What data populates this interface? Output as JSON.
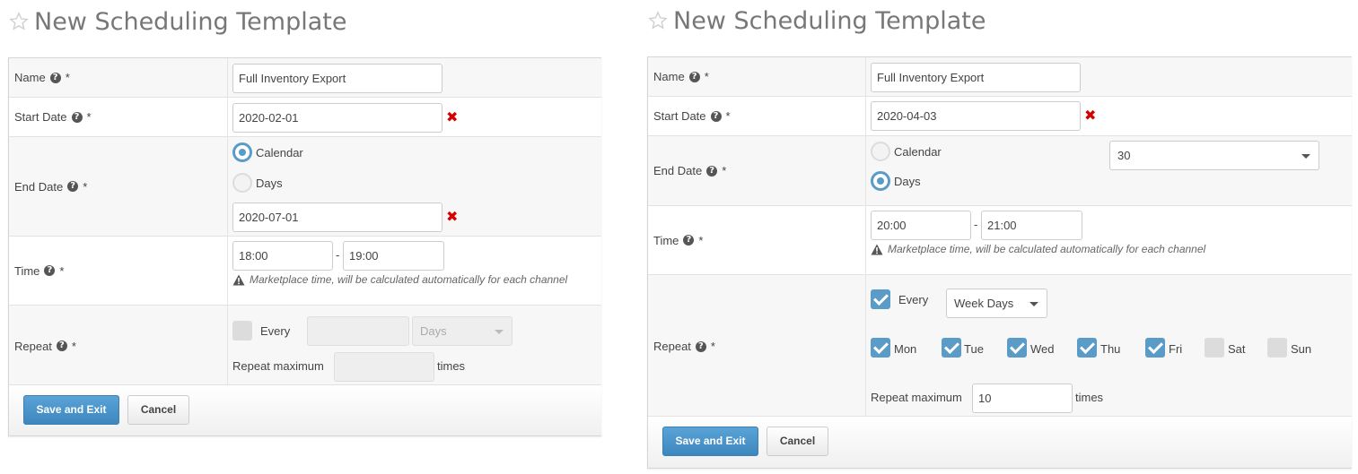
{
  "left_form": {
    "title": "New Scheduling Template",
    "name_label": "Name",
    "start_label": "Start Date",
    "end_label": "End Date",
    "time_label": "Time",
    "repeat_label": "Repeat",
    "required_mark": "*",
    "help_glyph": "?",
    "name_value": "Full Inventory Export",
    "start_value": "2020-02-01",
    "end_calendar_label": "Calendar",
    "end_days_label": "Days",
    "end_mode": "Calendar",
    "end_value": "2020-07-01",
    "clear_glyph": "✖",
    "time_from": "18:00",
    "time_to": "19:00",
    "time_separator": "-",
    "time_note": "Marketplace time, will be calculated automatically for each channel",
    "repeat_checked": false,
    "every_label": "Every",
    "every_value": "",
    "unit_value": "Days",
    "repeat_max_label": "Repeat maximum",
    "repeat_max_value": "",
    "times_label": "times",
    "save_label": "Save and Exit",
    "cancel_label": "Cancel"
  },
  "right_form": {
    "title": "New Scheduling Template",
    "name_label": "Name",
    "start_label": "Start Date",
    "end_label": "End Date",
    "time_label": "Time",
    "repeat_label": "Repeat",
    "required_mark": "*",
    "help_glyph": "?",
    "name_value": "Full Inventory Export",
    "start_value": "2020-04-03",
    "end_calendar_label": "Calendar",
    "end_days_label": "Days",
    "end_mode": "Days",
    "days_value": "30",
    "clear_glyph": "✖",
    "time_from": "20:00",
    "time_to": "21:00",
    "time_separator": "-",
    "time_note": "Marketplace time, will be calculated automatically for each channel",
    "repeat_checked": true,
    "every_label": "Every",
    "unit_value": "Week Days",
    "weekdays": [
      {
        "label": "Mon",
        "checked": true
      },
      {
        "label": "Tue",
        "checked": true
      },
      {
        "label": "Wed",
        "checked": true
      },
      {
        "label": "Thu",
        "checked": true
      },
      {
        "label": "Fri",
        "checked": true
      },
      {
        "label": "Sat",
        "checked": false
      },
      {
        "label": "Sun",
        "checked": false
      }
    ],
    "repeat_max_label": "Repeat maximum",
    "repeat_max_value": "10",
    "times_label": "times",
    "save_label": "Save and Exit",
    "cancel_label": "Cancel"
  },
  "colors": {
    "accent": "#5b9bc8",
    "primary_button": "#3d87bf",
    "error": "#d40000",
    "title_text": "#777777"
  }
}
